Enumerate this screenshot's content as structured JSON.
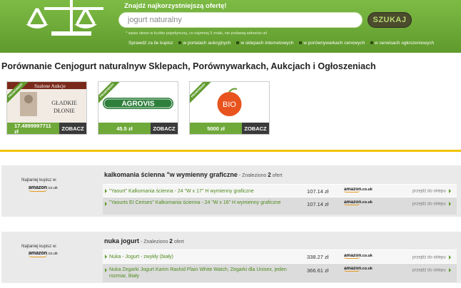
{
  "header": {
    "search_title": "Znajdź najkorzystniejszą ofertę!",
    "search_value": "jogurt naturalny",
    "search_button": "SZUKAJ",
    "hint": "* wpisz słowo w liczbie pojedynczej, co najmniej 3 znaki, nie podawaj adresów url",
    "links": [
      "Sprawdź za ile kupisz",
      "w portalach aukcyjnych",
      "w sklepach internetowych",
      "w porównywarkach cenowych",
      "w serwisach ogłoszeniowych"
    ],
    "colors": {
      "green": "#6fa93a",
      "dark_button": "#4b4b2e",
      "accent_yellow": "#f2c200"
    }
  },
  "heading": "Porównanie Cenjogurt naturalnyw Sklepach, Porównywarkach, Aukcjach i Ogłoszeniach",
  "cards": [
    {
      "ribbon": "PROMOWANY",
      "image_text": "Gładkie Dłonie",
      "image_top": "Szalone Aukcje",
      "price_line1": "17.4899997711",
      "price_line2": "zł",
      "button": "ZOBACZ"
    },
    {
      "ribbon": "PROMOWANY",
      "image_text": "AGROVIS",
      "price": "45.5 zł",
      "button": "ZOBACZ"
    },
    {
      "ribbon": "PROMOWANY",
      "image_text": "BIO",
      "price": "5000 zł",
      "button": "ZOBACZ"
    }
  ],
  "results": [
    {
      "cheapest_label": "Najtaniej kupisz w:",
      "shop": "amazon",
      "shop_suffix": ".co.uk",
      "title": "kalkomania ścienna \"w wymienny graficzne",
      "found_label": " - Znaleziono ",
      "found_count": "2",
      "found_suffix": " ofert",
      "offers": [
        {
          "name": "\"Yaourt\" Kalkomania ścienna - 24 \"W x 17\" H wymienny graficzne",
          "price": "107.14 zł",
          "shop": "amazon",
          "shop_suffix": ".co.uk",
          "go": "przejdź do sklepu"
        },
        {
          "name": "\"Yaourts Et Cerises\" Kalkomania ścienna - 24 \"W x 16\" H wymienny graficzne",
          "price": "107.14 zł",
          "shop": "amazon",
          "shop_suffix": ".co.uk",
          "go": "przejdź do sklepu"
        }
      ]
    },
    {
      "cheapest_label": "Najtaniej kupisz w:",
      "shop": "amazon",
      "shop_suffix": ".co.uk",
      "title": "nuka jogurt",
      "found_label": " - Znaleziono ",
      "found_count": "2",
      "found_suffix": " ofert",
      "offers": [
        {
          "name": "Nuka - Jogurt - zwykły (biały)",
          "price": "338.27 zł",
          "shop": "amazon",
          "shop_suffix": ".co.uk",
          "go": "przejdź do sklepu"
        },
        {
          "name": "Nuka Zegarki Jogurt Karim Rashid Plain White Watch, Zegarki dla Unisex, jeden rozmiar, Biały",
          "price": "366.61 zł",
          "shop": "amazon",
          "shop_suffix": ".co.uk",
          "go": "przejdź do sklepu"
        }
      ]
    }
  ]
}
